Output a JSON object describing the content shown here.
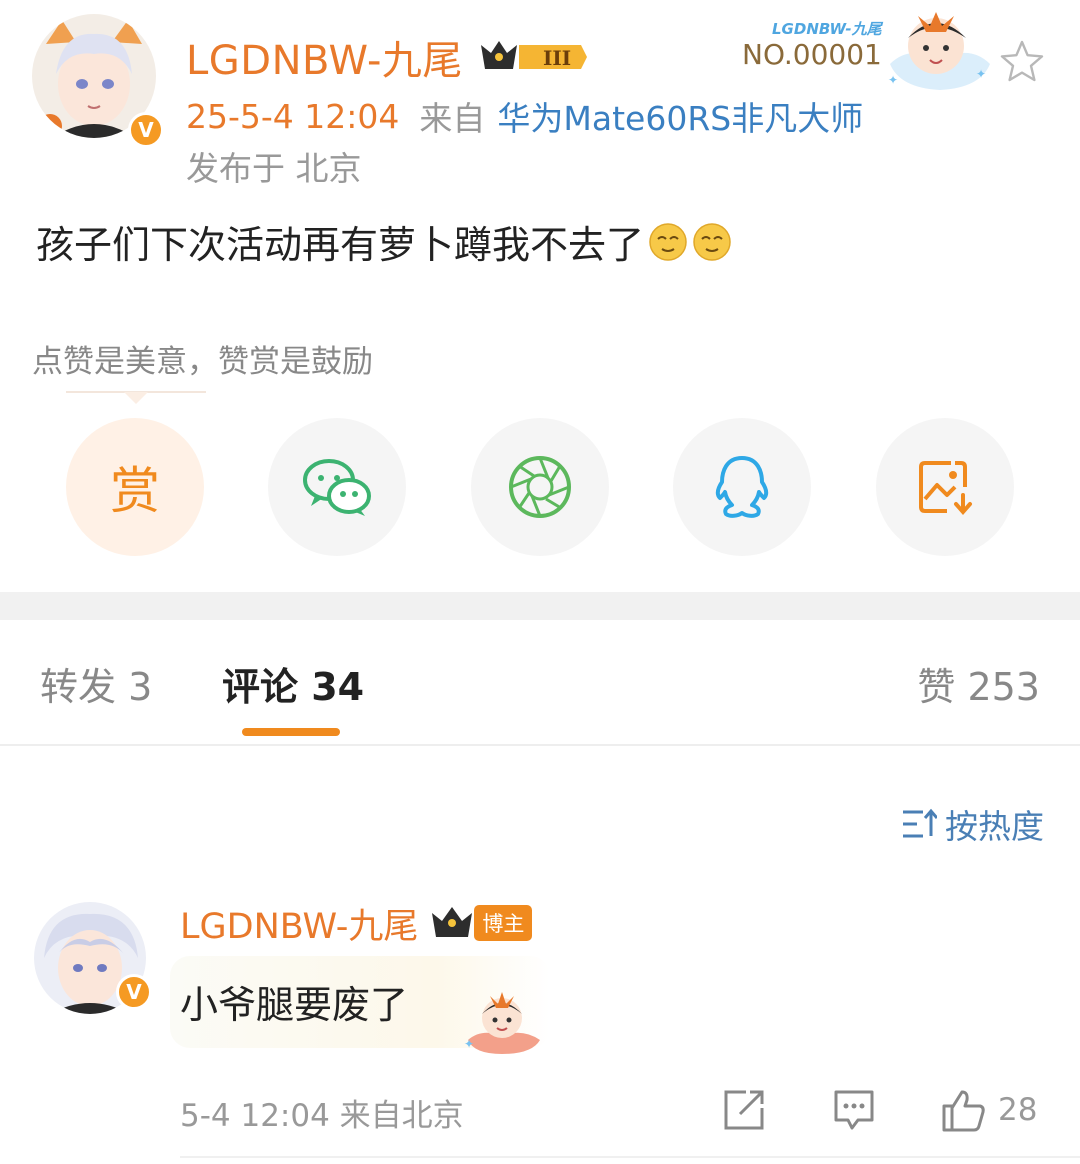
{
  "post": {
    "author": "LGDNBW-九尾",
    "level_badge": "III",
    "time": "25-5-4 12:04",
    "from_label": "来自",
    "device": "华为Mate60RS非凡大师",
    "location": "发布于 北京",
    "text": "孩子们下次活动再有萝卜蹲我不去了",
    "emoji_count": 2
  },
  "fan_card": {
    "brand": "LGDNBW-九尾",
    "number": "NO.00001"
  },
  "reward": {
    "hint": "点赞是美意，赞赏是鼓励",
    "reward_label": "赏"
  },
  "share_targets": [
    "reward-icon",
    "wechat-icon",
    "moments-icon",
    "qq-icon",
    "save-image-icon"
  ],
  "tabs": {
    "repost": "转发 3",
    "comments": "评论 34",
    "likes": "赞 253"
  },
  "sort": {
    "label": "按热度"
  },
  "comment": {
    "author": "LGDNBW-九尾",
    "tag": "博主",
    "text": "小爷腿要废了",
    "meta": "5-4 12:04 来自北京",
    "likes": "28"
  },
  "colors": {
    "accent_orange": "#e8792b",
    "link_blue": "#3a7fc1",
    "wechat_green": "#3cb371",
    "qq_blue": "#2ea8e6"
  }
}
